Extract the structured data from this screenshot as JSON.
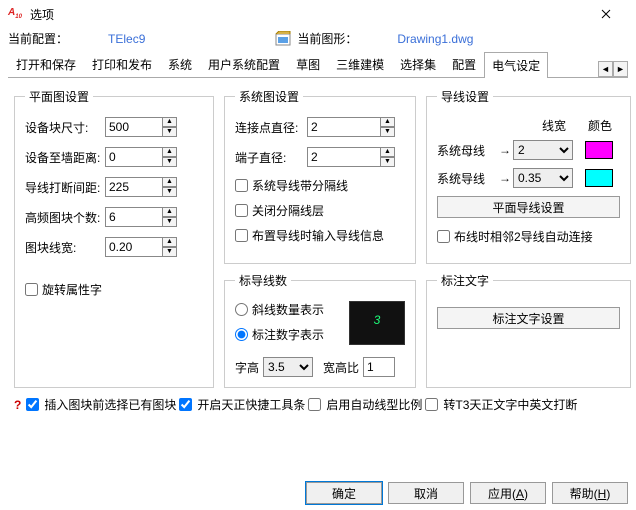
{
  "domain": "Computer-Use",
  "title": "选项",
  "header": {
    "current_profile_lbl": "当前配置：",
    "current_profile_val": "TElec9",
    "current_drawing_lbl": "当前图形：",
    "current_drawing_val": "Drawing1.dwg"
  },
  "tabs": {
    "items": [
      "打开和保存",
      "打印和发布",
      "系统",
      "用户系统配置",
      "草图",
      "三维建模",
      "选择集",
      "配置",
      "电气设定"
    ],
    "active": 8
  },
  "plan": {
    "legend": "平面图设置",
    "block_size_lbl": "设备块尺寸:",
    "block_size_val": "500",
    "wall_dist_lbl": "设备至墙距离:",
    "wall_dist_val": "0",
    "break_gap_lbl": "导线打断间距:",
    "break_gap_val": "225",
    "hf_count_lbl": "高频图块个数:",
    "hf_count_val": "6",
    "lw_lbl": "图块线宽:",
    "lw_val": "0.20",
    "rotate_attr_lbl": "旋转属性字"
  },
  "sys": {
    "legend": "系统图设置",
    "conn_diam_lbl": "连接点直径:",
    "conn_diam_val": "2",
    "term_diam_lbl": "端子直径:",
    "term_diam_val": "2",
    "sep_line_lbl": "系统导线带分隔线",
    "close_sep_lbl": "关闭分隔线层",
    "prompt_info_lbl": "布置导线时输入导线信息"
  },
  "wire": {
    "legend": "导线设置",
    "col_lw": "线宽",
    "col_color": "颜色",
    "busbar_lbl": "系统母线",
    "busbar_lw": "2",
    "busbar_color": "#ff00ff",
    "syswire_lbl": "系统导线",
    "syswire_lw": "0.35",
    "syswire_color": "#00ffff",
    "plan_wire_btn": "平面导线设置",
    "auto_conn_lbl": "布线时相邻2导线自动连接"
  },
  "count": {
    "legend": "标导线数",
    "slash_lbl": "斜线数量表示",
    "digit_lbl": "标注数字表示",
    "preview_value": "3",
    "char_h_lbl": "字高",
    "char_h_val": "3.5",
    "aspect_lbl": "宽高比",
    "aspect_val": "1"
  },
  "text": {
    "legend": "标注文字",
    "btn": "标注文字设置"
  },
  "footer": {
    "opt1": "插入图块前选择已有图块",
    "opt2": "开启天正快捷工具条",
    "opt3": "启用自动线型比例",
    "opt4": "转T3天正文字中英文打断"
  },
  "buttons": {
    "ok": "确定",
    "cancel": "取消",
    "apply": "应用(",
    "apply_u": "A",
    "apply_end": ")",
    "help": "帮助(",
    "help_u": "H",
    "help_end": ")"
  }
}
